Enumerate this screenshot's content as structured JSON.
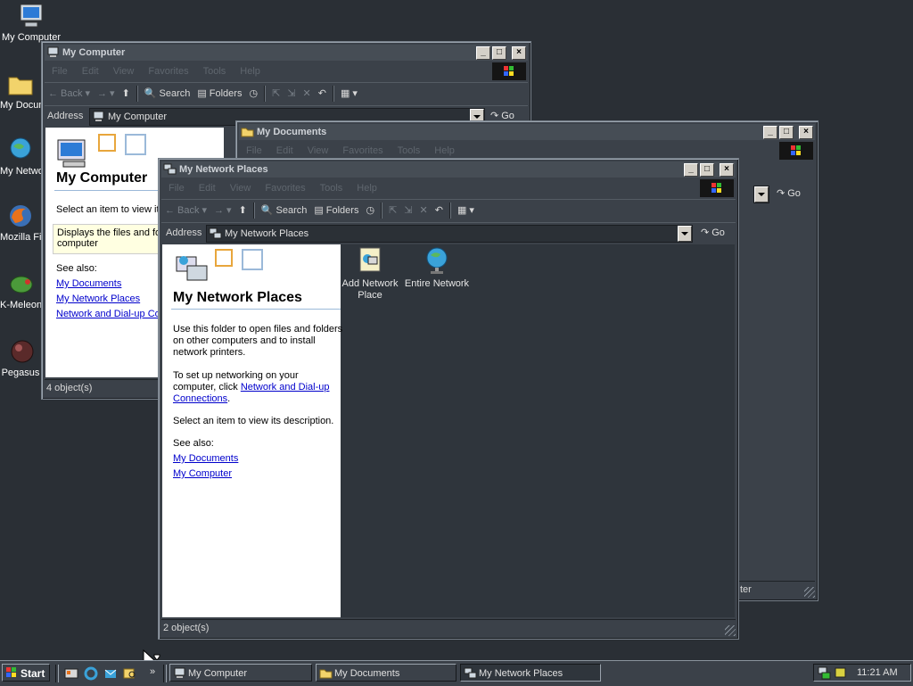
{
  "desktop": {
    "icons": [
      {
        "label": "My Computer"
      },
      {
        "label": "My Documents"
      },
      {
        "label": "My Network Places"
      },
      {
        "label": "Mozilla Firefox"
      },
      {
        "label": "K-Meleon"
      },
      {
        "label": "Pegasus"
      }
    ]
  },
  "windows": {
    "my_computer": {
      "title": "My Computer",
      "menu": [
        "File",
        "Edit",
        "View",
        "Favorites",
        "Tools",
        "Help"
      ],
      "toolbar": {
        "back": "Back",
        "search": "Search",
        "folders": "Folders"
      },
      "address_label": "Address",
      "address_value": "My Computer",
      "go": "Go",
      "pane_title": "My Computer",
      "select_text": "Select an item to view it",
      "desc_text1": "Displays the files and fo",
      "desc_text2": "computer",
      "see_also": "See also:",
      "links": [
        "My Documents",
        "My Network Places",
        "Network and Dial-up Co"
      ],
      "status": "4 object(s)"
    },
    "my_documents": {
      "title": "My Documents",
      "menu": [
        "File",
        "Edit",
        "View",
        "Favorites",
        "Tools",
        "Help"
      ],
      "go": "Go",
      "status_fragment": "ter"
    },
    "network_places": {
      "title": "My Network Places",
      "menu": [
        "File",
        "Edit",
        "View",
        "Favorites",
        "Tools",
        "Help"
      ],
      "toolbar": {
        "back": "Back",
        "search": "Search",
        "folders": "Folders"
      },
      "address_label": "Address",
      "address_value": "My Network Places",
      "go": "Go",
      "pane_title": "My Network Places",
      "para1": [
        "Use this folder to open files and folders",
        "on other computers and to install",
        "network printers."
      ],
      "para2_a": "To set up networking on your",
      "para2_b": "computer, click ",
      "para2_link1": "Network and Dial-up",
      "para2_link2": "Connections",
      "para2_end": ".",
      "select_text": "Select an item to view its description.",
      "see_also": "See also:",
      "links": [
        "My Documents",
        "My Computer"
      ],
      "items": [
        {
          "label_line1": "Add Network",
          "label_line2": "Place"
        },
        {
          "label_line1": "Entire Network",
          "label_line2": ""
        }
      ],
      "status": "2 object(s)"
    }
  },
  "taskbar": {
    "start": "Start",
    "buttons": [
      "My Computer",
      "My Documents",
      "My Network Places"
    ],
    "clock": "11:21 AM",
    "chevron": "»"
  }
}
